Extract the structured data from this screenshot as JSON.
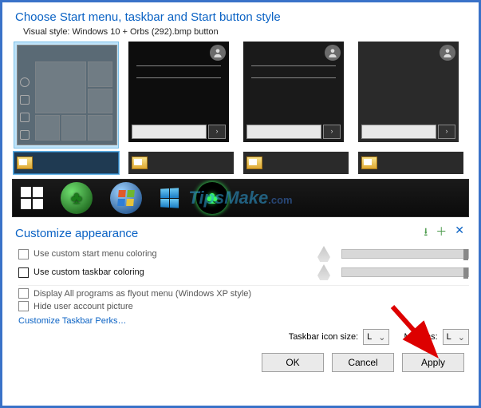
{
  "header": {
    "title": "Choose Start menu, taskbar and Start button style",
    "subtitle": "Visual style:  Windows 10 + Orbs (292).bmp button"
  },
  "customize": {
    "title": "Customize appearance",
    "opt1": "Use custom start menu coloring",
    "opt2": "Use custom taskbar coloring",
    "opt3": "Display All programs as flyout menu (Windows XP style)",
    "opt4": "Hide user account picture",
    "link": "Customize Taskbar Perks…"
  },
  "controls": {
    "iconsize_label": "Taskbar icon size:",
    "iconsize_value": "L",
    "margins_label": "Margins:",
    "margins_value": "L"
  },
  "buttons": {
    "ok": "OK",
    "cancel": "Cancel",
    "apply": "Apply"
  },
  "watermark": "TipsMake",
  "watermark_suffix": ".com"
}
